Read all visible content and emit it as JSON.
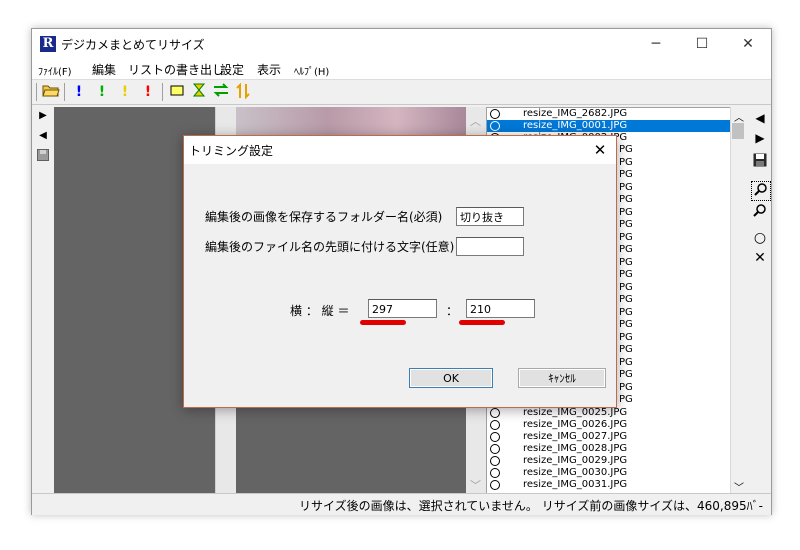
{
  "window": {
    "title": "デジカメまとめてリサイズ",
    "logo_letter": "R",
    "minimize": "─",
    "maximize": "☐",
    "close": "✕"
  },
  "menu": [
    "ﾌｧｲﾙ(F)",
    "編集",
    "リストの書き出し",
    "設定",
    "表示",
    "ﾍﾙﾌﾟ(H)"
  ],
  "toolbar": {
    "icons": [
      "open-folder-icon",
      "exclamation-blue-icon",
      "exclamation-green-icon",
      "exclamation-yellow-icon",
      "exclamation-red-icon",
      "rectangle-icon",
      "hourglass-icon",
      "swap-horizontal-icon",
      "swap-vertical-icon"
    ],
    "colors": {
      "blue": "#0000ff",
      "green": "#00b000",
      "yellow": "#e8d000",
      "red": "#ff0000"
    }
  },
  "file_list": {
    "items": [
      "resize_IMG_2682.JPG",
      "resize_IMG_0001.JPG",
      "resize_IMG_0002.JPG",
      "resize_IMG_0025.JPG",
      "resize_IMG_0026.JPG",
      "resize_IMG_0027.JPG",
      "resize_IMG_0028.JPG",
      "resize_IMG_0029.JPG",
      "resize_IMG_0030.JPG",
      "resize_IMG_0031.JPG"
    ],
    "selected_index": 1,
    "hidden_suffix": "PG",
    "select_color": "#0078d7"
  },
  "status": {
    "text": "リサイズ後の画像は、選択されていません。 リサイズ前の画像サイズは、460,895ﾊﾞ-"
  },
  "dialog": {
    "title": "トリミング設定",
    "close": "✕",
    "folder_label": "編集後の画像を保存するフォルダー名(必須)",
    "folder_value": "切り抜き",
    "prefix_label": "編集後のファイル名の先頭に付ける文字(任意)",
    "prefix_value": "",
    "ratio_label": "横 ： 縦 ＝",
    "ratio_sep": "：",
    "width_value": "297",
    "height_value": "210",
    "ok_label": "OK",
    "cancel_label": "ｷｬﾝｾﾙ",
    "highlight_color": "#e00000",
    "border_color": "#c06a4a"
  }
}
